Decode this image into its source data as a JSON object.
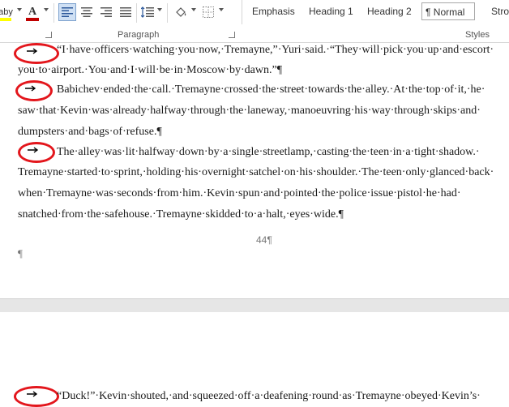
{
  "ribbon": {
    "groups": {
      "paragraph": "Paragraph",
      "styles": "Styles"
    },
    "styles_gallery": [
      {
        "label": "Emphasis",
        "selected": false
      },
      {
        "label": "Heading 1",
        "selected": false
      },
      {
        "label": "Heading 2",
        "selected": false
      },
      {
        "label": "¶ Normal",
        "selected": true
      },
      {
        "label": "Stro",
        "selected": false
      }
    ],
    "font_color": "#c00000",
    "accent": "#2b579a"
  },
  "document": {
    "page1_lines": [
      "“I·have·officers·watching·you·now,·Tremayne,”·Yuri·said.·“They·will·pick·you·up·and·escort·",
      "you·to·airport.·You·and·I·will·be·in·Moscow·by·dawn.”¶",
      "Babichev·ended·the·call.·Tremayne·crossed·the·street·towards·the·alley.·At·the·top·of·it,·he·",
      "saw·that·Kevin·was·already·halfway·through·the·laneway,·manoeuvring·his·way·through·skips·and·",
      "dumpsters·and·bags·of·refuse.¶",
      "The·alley·was·lit·halfway·down·by·a·single·streetlamp,·casting·the·teen·in·a·tight·shadow.·",
      "Tremayne·started·to·sprint,·holding·his·overnight·satchel·on·his·shoulder.·The·teen·only·glanced·back·",
      "when·Tremayne·was·seconds·from·him.·Kevin·spun·and·pointed·the·police·issue·pistol·he·had·",
      "snatched·from·the·safehouse.·Tremayne·skidded·to·a·halt,·eyes·wide.¶"
    ],
    "page_number": "44¶",
    "empty_paragraph": "¶",
    "page2_lines": [
      "“Duck!”·Kevin·shouted,·and·squeezed·off·a·deafening·round·as·Tremayne·obeyed·Kevin’s·"
    ],
    "highlight_color": "#e3161c"
  }
}
